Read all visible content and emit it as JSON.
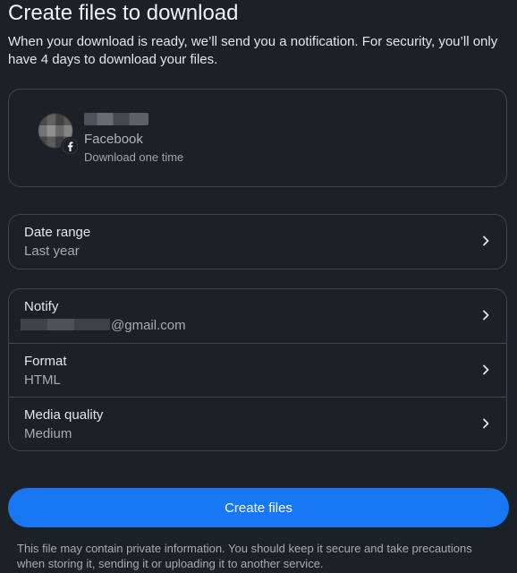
{
  "header": {
    "title": "Create files to download",
    "subtitle": "When your download is ready, we’ll send you a notification. For security, you’ll only have 4 days to download your files."
  },
  "account": {
    "platform": "Facebook",
    "note": "Download one time",
    "badge_icon": "facebook-icon"
  },
  "settings_date": {
    "label": "Date range",
    "value": "Last year"
  },
  "settings": {
    "notify": {
      "label": "Notify",
      "value_suffix": "@gmail.com"
    },
    "format": {
      "label": "Format",
      "value": "HTML"
    },
    "media_quality": {
      "label": "Media quality",
      "value": "Medium"
    }
  },
  "actions": {
    "create_label": "Create files"
  },
  "disclaimer": "This file may contain private information. You should keep it secure and take precautions when storing it, sending it or uploading it to another service.",
  "colors": {
    "background": "#1c2128",
    "border": "#3e4450",
    "primary_button": "#1877f2"
  }
}
